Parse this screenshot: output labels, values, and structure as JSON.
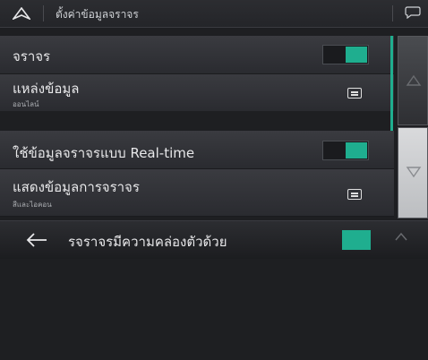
{
  "header": {
    "title": "ตั้งค่าข้อมูลจราจร"
  },
  "rows": [
    {
      "label": "จราจร",
      "toggle": true
    },
    {
      "label": "แหล่งข้อมูล",
      "sub": "ออนไลน์"
    },
    {
      "label": "ใช้ข้อมูลจราจรแบบ Real-time",
      "toggle": true
    },
    {
      "label": "แสดงข้อมูลการจราจร",
      "sub": "สีและไอคอน"
    },
    {
      "label": "รจราจรมีความคล่องตัวด้วย",
      "toggle": true
    }
  ],
  "colors": {
    "accent": "#1fae8f"
  },
  "icons": {
    "header_left": "navigation-arrow-icon",
    "header_right": "chat-bubble-icon",
    "row_action": "list-icon",
    "side_up": "scroll-up-icon",
    "side_down": "scroll-down-icon",
    "footer_back": "back-arrow-icon",
    "footer_up": "chevron-up-icon"
  }
}
